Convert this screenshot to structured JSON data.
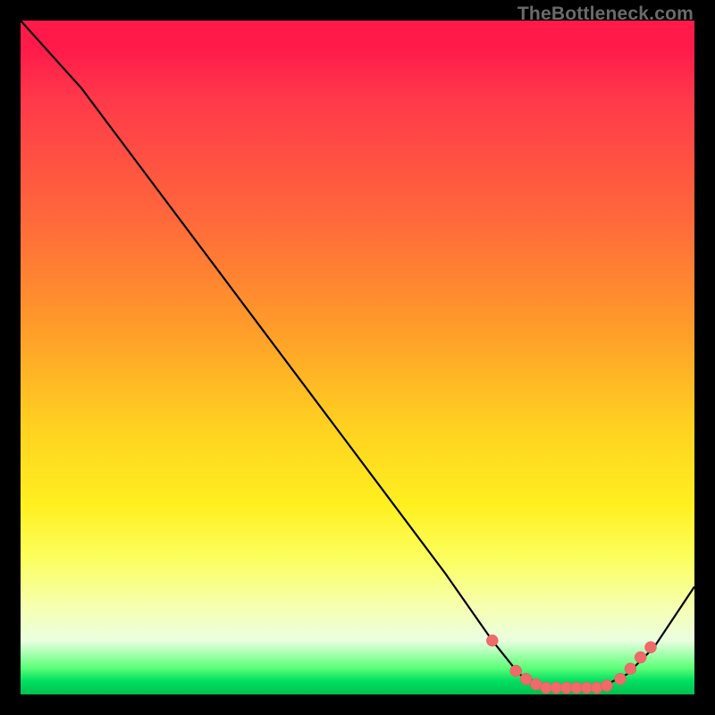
{
  "watermark": "TheBottleneck.com",
  "colors": {
    "background": "#000000",
    "curve": "#000000",
    "marker_fill": "#f06a6a",
    "marker_stroke": "#e05a5a"
  },
  "chart_data": {
    "type": "line",
    "title": "",
    "xlabel": "",
    "ylabel": "",
    "xlim": [
      0,
      100
    ],
    "ylim": [
      0,
      100
    ],
    "grid": false,
    "series": [
      {
        "name": "curve",
        "x": [
          0,
          9,
          18,
          27,
          36,
          45,
          54,
          63,
          70,
          74,
          78,
          82,
          86,
          90,
          94,
          100
        ],
        "y": [
          100,
          90,
          78,
          66,
          54,
          42,
          30,
          18,
          8,
          3,
          1,
          1,
          1,
          3,
          7,
          16
        ]
      }
    ],
    "markers": {
      "x": [
        70.0,
        73.5,
        75.0,
        76.5,
        78.0,
        79.5,
        81.0,
        82.5,
        84.0,
        85.5,
        87.0,
        89.0,
        90.5,
        92.0,
        93.5
      ],
      "y": [
        8.0,
        3.5,
        2.3,
        1.5,
        1.0,
        1.0,
        1.0,
        1.0,
        1.0,
        1.0,
        1.3,
        2.3,
        3.8,
        5.5,
        7.0
      ]
    }
  }
}
